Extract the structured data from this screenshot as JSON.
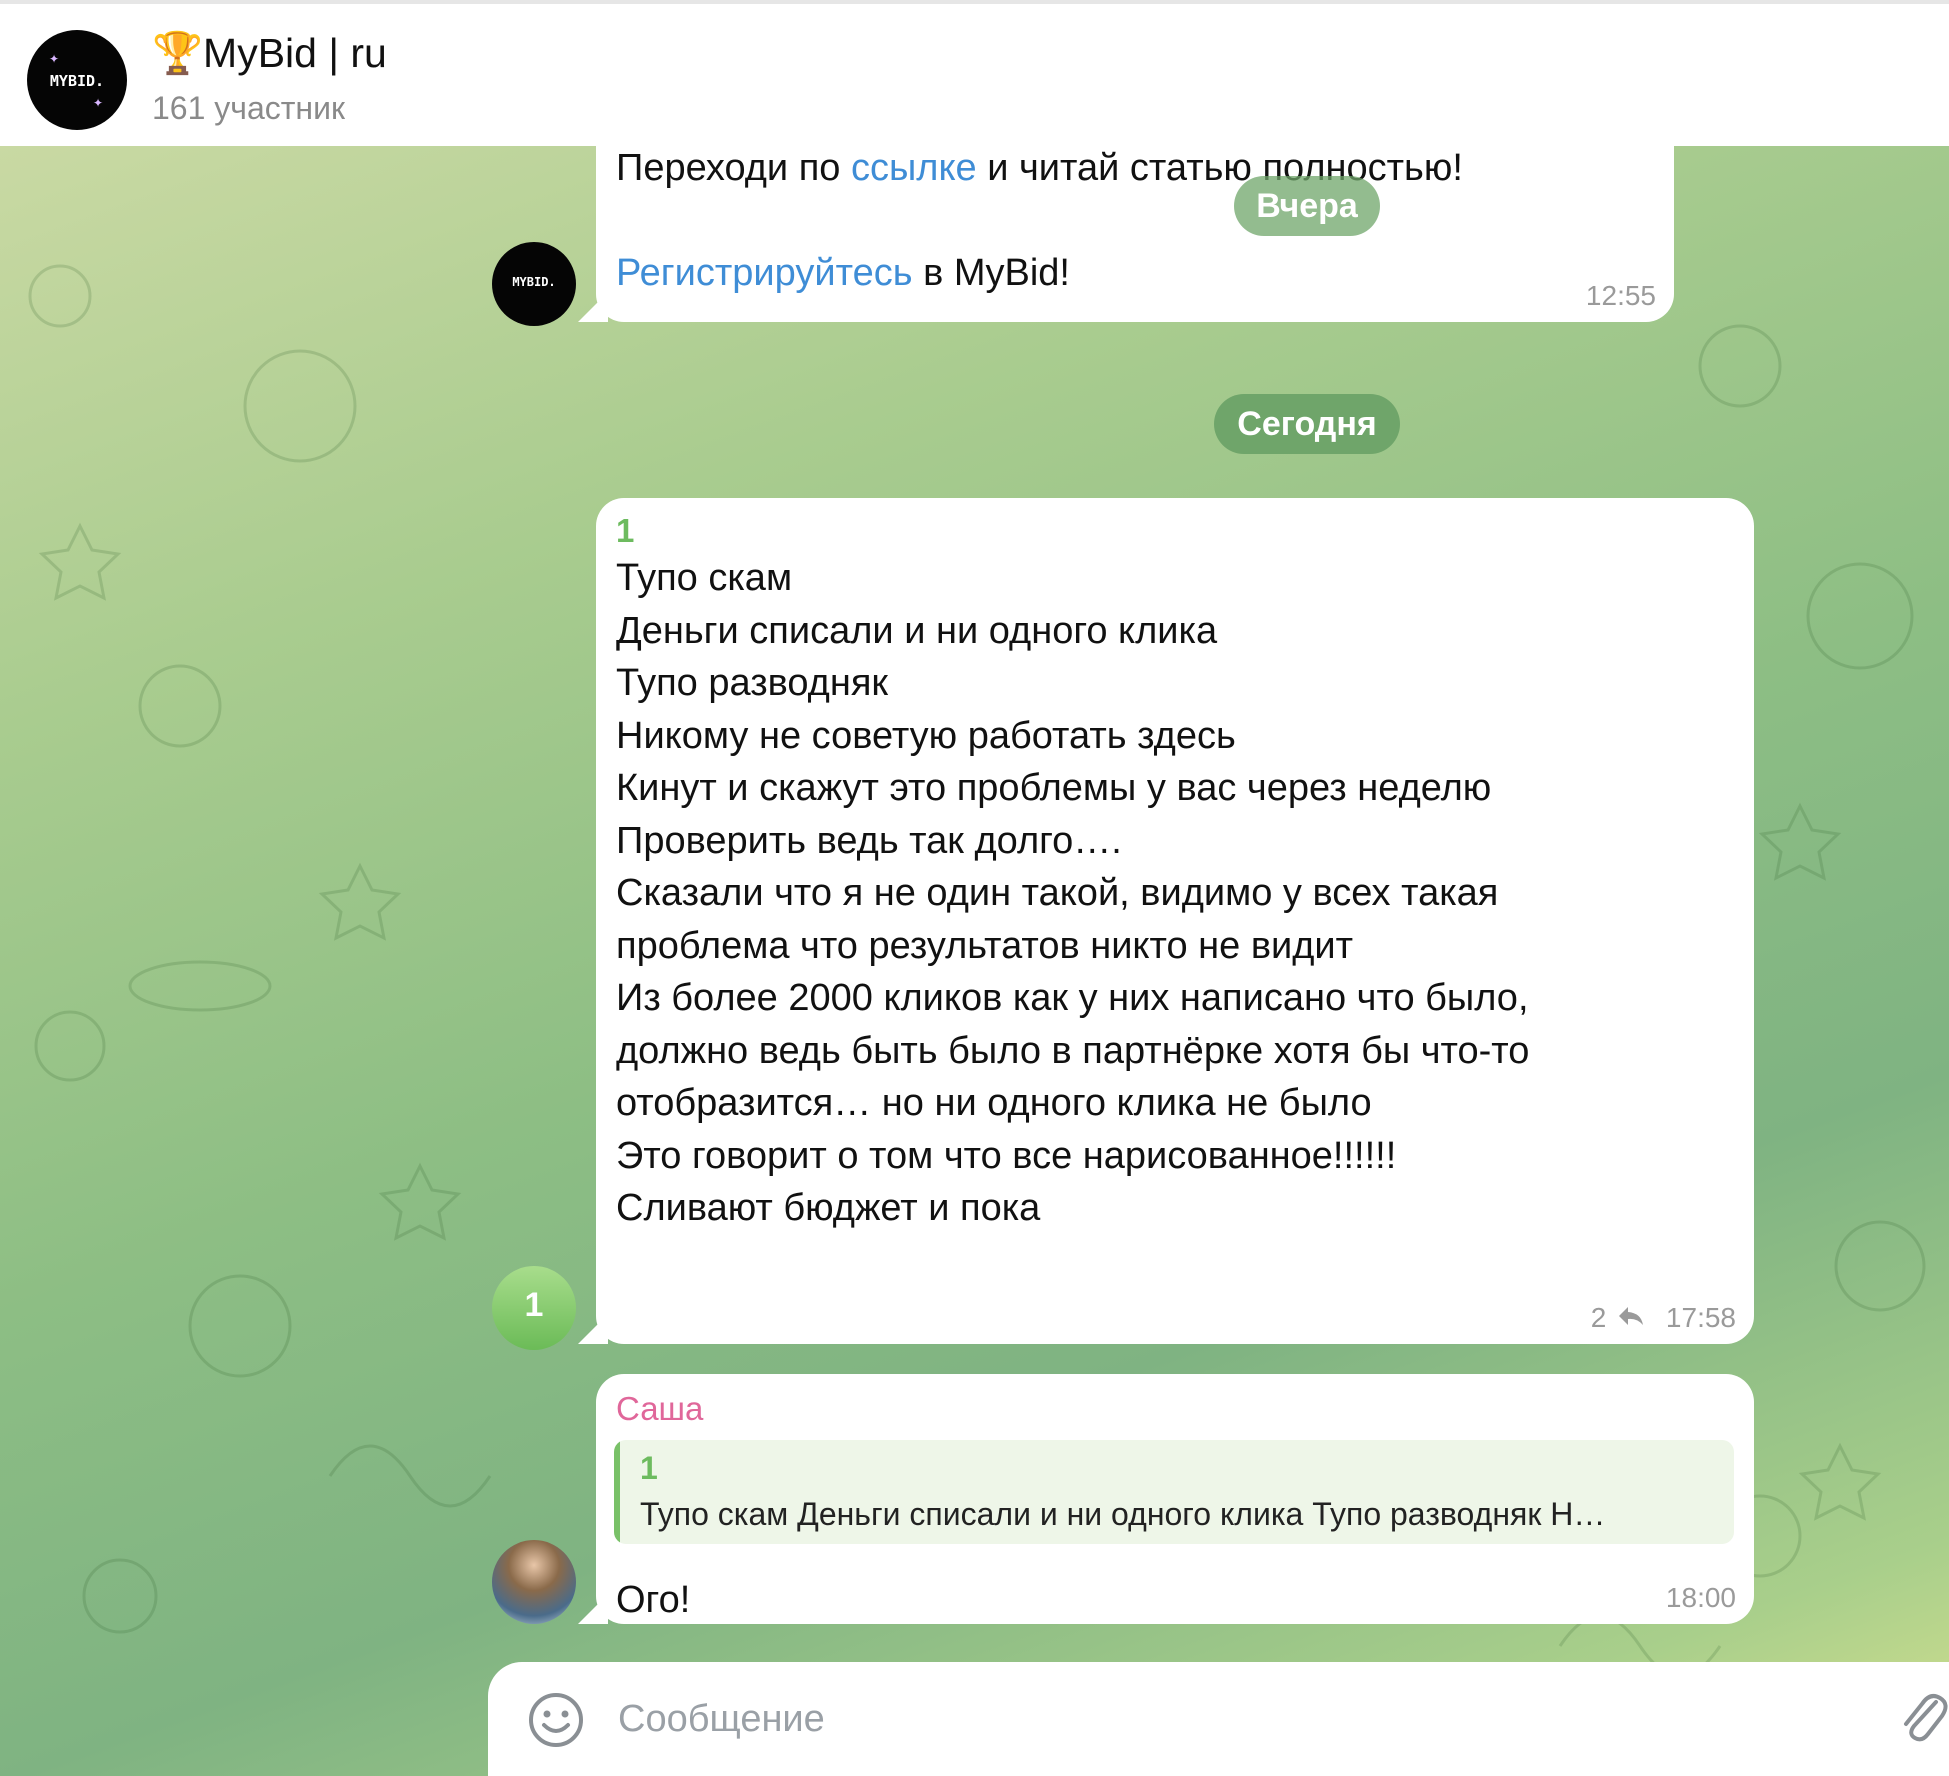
{
  "header": {
    "title": "🏆MyBid | ru",
    "subtitle": "161 участник",
    "logo_text": "MYBID."
  },
  "messages": [
    {
      "lines": [
        {
          "before": "Переходи по ",
          "link": "ссылке",
          "after": " и читай статью полностью!"
        },
        {
          "link": "Регистрируйтесь",
          "after": " в MyBid!"
        }
      ],
      "time": "12:55"
    },
    {
      "sender_name": "1",
      "avatar_letter": "1",
      "lines": [
        "Тупо скам",
        "Деньги списали и ни одного клика",
        "Тупо разводняк",
        "Никому не советую работать здесь",
        "Кинут и скажут это проблемы у вас через неделю",
        "Проверить ведь так долго….",
        "Сказали что я не один такой, видимо у всех такая",
        "проблема что результатов никто не видит",
        "Из более 2000 кликов как у них написано что было,",
        "должно ведь быть было в партнёрке хотя бы что-то",
        "отобразится… но ни одного клика не было",
        "Это говорит о том что все нарисованное!!!!!!",
        "Сливают бюджет и пока"
      ],
      "reactions": [
        "😁",
        "user-avatar"
      ],
      "replies": "2",
      "time": "17:58"
    },
    {
      "sender_name": "Саша",
      "reply_to": {
        "author": "1",
        "preview": "Тупо скам Деньги списали и ни одного клика Тупо разводняк Н…"
      },
      "text": "Ого!",
      "time": "18:00"
    }
  ],
  "date_separators": {
    "yesterday": "Вчера",
    "today": "Сегодня"
  },
  "composer": {
    "placeholder": "Сообщение"
  },
  "colors": {
    "link": "#3f8dd6",
    "sender_green": "#6dbb5f",
    "sender_pink": "#e0679a",
    "pill_bg": "#6fa56a"
  }
}
